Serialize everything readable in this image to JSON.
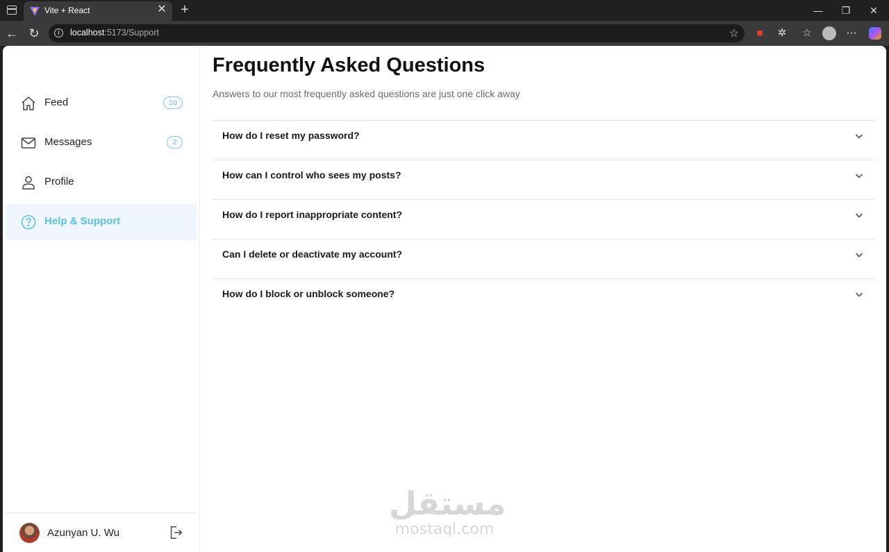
{
  "browser": {
    "tab_title": "Vite + React",
    "url_host": "localhost",
    "url_path": ":5173/Support"
  },
  "sidebar": {
    "items": [
      {
        "label": "Feed",
        "icon": "home-icon",
        "badge": "10"
      },
      {
        "label": "Messages",
        "icon": "mail-icon",
        "badge": "2"
      },
      {
        "label": "Profile",
        "icon": "user-icon"
      },
      {
        "label": "Help & Support",
        "icon": "help-circle-icon",
        "active": true
      }
    ],
    "user": {
      "name": "Azunyan U. Wu"
    }
  },
  "main": {
    "title": "Frequently Asked Questions",
    "subtitle": "Answers to our most frequently asked questions are just one click away",
    "faqs": [
      "How do I reset my password?",
      "How can I control who sees my posts?",
      "How do I report inappropriate content?",
      "Can I delete or deactivate my account?",
      "How do I block or unblock someone?"
    ]
  },
  "watermark": {
    "arabic": "مستقل",
    "latin": "mostaql.com"
  },
  "colors": {
    "accent": "#5bc0eb",
    "active_bg": "#eff6fe",
    "badge_border": "#8dc3ec"
  }
}
